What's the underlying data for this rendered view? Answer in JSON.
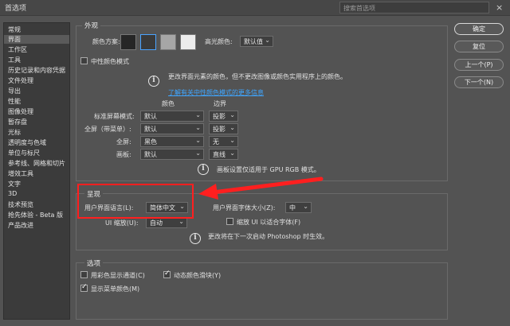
{
  "window": {
    "title": "首选项",
    "search_placeholder": "搜索首选项",
    "close": "×"
  },
  "sidebar": {
    "items": [
      "常规",
      "界面",
      "工作区",
      "工具",
      "历史记录和内容凭据",
      "文件处理",
      "导出",
      "性能",
      "图像处理",
      "暂存盘",
      "光标",
      "透明度与色域",
      "单位与标尺",
      "参考线、网格和切片",
      "增效工具",
      "文字",
      "3D",
      "技术预览",
      "抢先体验 - Beta 版",
      "产品改进"
    ]
  },
  "appearance": {
    "legend": "外观",
    "color_scheme_label": "颜色方案:",
    "swatches": [
      "#262626",
      "#3a3a3a",
      "#a6a6a6",
      "#ececec"
    ],
    "highlight_label": "高光颜色:",
    "highlight_value": "默认值",
    "neutral_mode_label": "中性颜色模式",
    "neutral_info": "更改界面元素的颜色，但不更改图像或颜色实用程序上的颜色。",
    "neutral_link": "了解有关中性颜色模式的更多信息",
    "col_color": "颜色",
    "col_border": "边界",
    "rows": [
      {
        "label": "标准屏幕模式:",
        "color": "默认",
        "border": "投影"
      },
      {
        "label": "全屏（带菜单）:",
        "color": "默认",
        "border": "投影"
      },
      {
        "label": "全屏:",
        "color": "黑色",
        "border": "无"
      },
      {
        "label": "画板:",
        "color": "默认",
        "border": "直线"
      }
    ],
    "artboard_note": "画板设置仅适用于 GPU RGB 模式。"
  },
  "presentation": {
    "legend": "呈现",
    "ui_lang_label": "用户界面语言(L):",
    "ui_lang_value": "简体中文",
    "ui_font_label": "用户界面字体大小(Z):",
    "ui_font_value": "中",
    "ui_scale_label": "UI 缩放(U):",
    "ui_scale_value": "自动",
    "scale_fit_label": "缩放 UI 以适合字体(F)",
    "restart_note": "更改将在下一次启动 Photoshop 时生效。"
  },
  "options": {
    "legend": "选项",
    "channels_color": "用彩色显示通道(C)",
    "dynamic_sliders": "动态颜色滑块(Y)",
    "menu_colors": "显示菜单颜色(M)"
  },
  "buttons": {
    "ok": "确定",
    "reset": "复位",
    "prev": "上一个(P)",
    "next": "下一个(N)"
  },
  "annotation": {
    "red": "#ff1f1f"
  }
}
